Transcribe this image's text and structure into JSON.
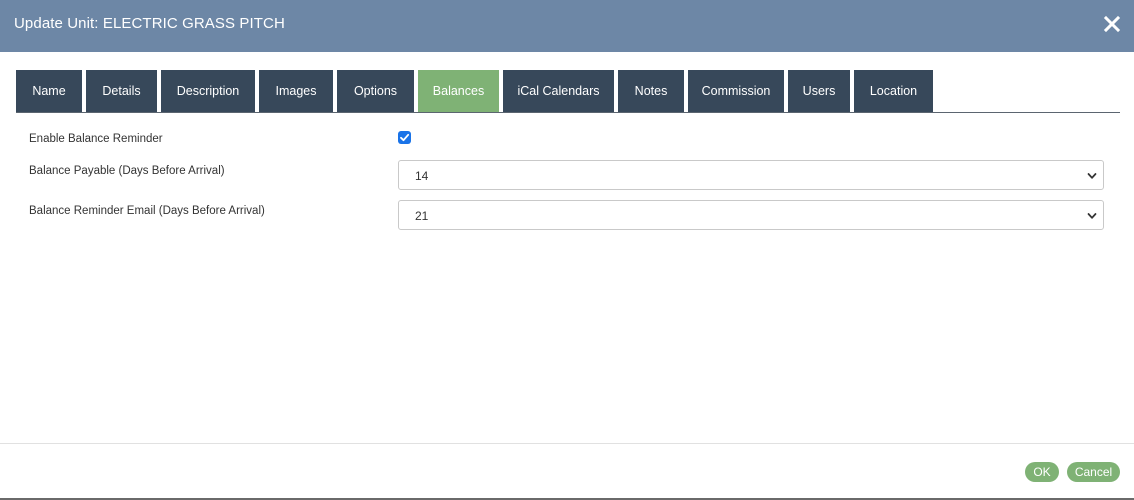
{
  "window": {
    "title": "Update Unit: ELECTRIC GRASS PITCH",
    "close_icon": "close-icon"
  },
  "tabs": [
    {
      "label": "Name"
    },
    {
      "label": "Details"
    },
    {
      "label": "Description"
    },
    {
      "label": "Images"
    },
    {
      "label": "Options"
    },
    {
      "label": "Balances",
      "active": true
    },
    {
      "label": "iCal Calendars"
    },
    {
      "label": "Notes"
    },
    {
      "label": "Commission"
    },
    {
      "label": "Users"
    },
    {
      "label": "Location"
    }
  ],
  "form": {
    "enable_reminder": {
      "label": "Enable Balance Reminder",
      "checked": true
    },
    "balance_payable": {
      "label": "Balance Payable (Days Before Arrival)",
      "value": "14"
    },
    "reminder_email": {
      "label": "Balance Reminder Email (Days Before Arrival)",
      "value": "21"
    }
  },
  "footer": {
    "ok_label": "OK",
    "cancel_label": "Cancel"
  },
  "colors": {
    "titlebar": "#6d87a6",
    "tab": "#37485a",
    "tab_active": "#7fb275",
    "button": "#7fb275",
    "checkbox": "#1a73e8"
  }
}
